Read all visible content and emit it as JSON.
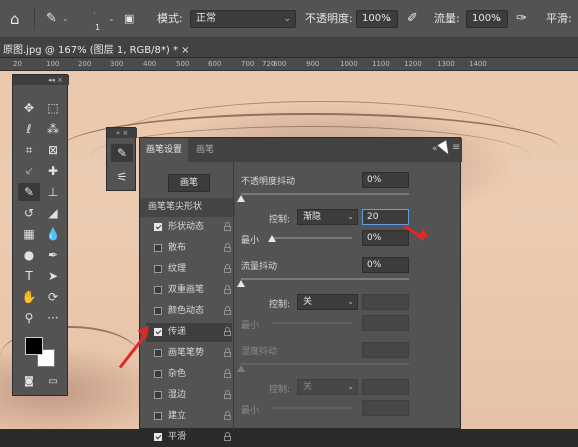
{
  "optbar": {
    "brush_size": "1",
    "mode_label": "模式:",
    "mode_value": "正常",
    "opacity_label": "不透明度:",
    "opacity_value": "100%",
    "flow_label": "流量:",
    "flow_value": "100%",
    "smooth_label": "平滑:"
  },
  "document": {
    "tab_title": "原图.jpg @ 167% (图层 1, RGB/8*) *",
    "close": "×"
  },
  "ruler": {
    "ticks": [
      "20",
      "100",
      "200",
      "300",
      "400",
      "500",
      "600",
      "700",
      "720",
      "800",
      "900",
      "1000",
      "1100",
      "1200",
      "1300",
      "1400"
    ]
  },
  "toolbar": {
    "collapse": "◂◂  ×",
    "tools": [
      "move-tool",
      "marquee-tool",
      "lasso-tool",
      "magic-wand-tool",
      "crop-tool",
      "frame-tool",
      "eyedropper-tool",
      "healing-brush-tool",
      "brush-tool",
      "clone-stamp-tool",
      "history-brush-tool",
      "eraser-tool",
      "gradient-tool",
      "blur-tool",
      "dodge-tool",
      "pen-tool",
      "type-tool",
      "path-selection-tool",
      "shape-tool",
      "hand-tool",
      "zoom-tool",
      "more-tools"
    ],
    "foreground_color": "#000000",
    "background_color": "#ffffff"
  },
  "mini_panel": {
    "header": "»  ×"
  },
  "brush_panel": {
    "tabs": [
      "画笔设置",
      "画笔"
    ],
    "active_tab": "画笔设置",
    "brush_button": "画笔",
    "tip_shape": "画笔笔尖形状",
    "sections": [
      {
        "label": "形状动态",
        "checked": true
      },
      {
        "label": "散布",
        "checked": false
      },
      {
        "label": "纹理",
        "checked": false
      },
      {
        "label": "双重画笔",
        "checked": false
      },
      {
        "label": "颜色动态",
        "checked": false
      },
      {
        "label": "传递",
        "checked": true
      },
      {
        "label": "画笔笔势",
        "checked": false
      },
      {
        "label": "杂色",
        "checked": false
      },
      {
        "label": "湿边",
        "checked": false
      },
      {
        "label": "建立",
        "checked": false
      },
      {
        "label": "平滑",
        "checked": true
      }
    ],
    "settings": {
      "opacity_jitter_label": "不透明度抖动",
      "opacity_jitter_value": "0%",
      "control1_label": "控制:",
      "control1_value": "渐隐",
      "control1_steps": "20",
      "min1_label": "最小",
      "min1_value": "0%",
      "flow_jitter_label": "流量抖动",
      "flow_jitter_value": "0%",
      "control2_label": "控制:",
      "control2_value": "关",
      "min2_label": "最小",
      "wetness_jitter_label": "湿度抖动",
      "control3_label": "控制:",
      "control3_value": "关",
      "min3_label": "最小"
    }
  },
  "annotation_color": "#e02828"
}
